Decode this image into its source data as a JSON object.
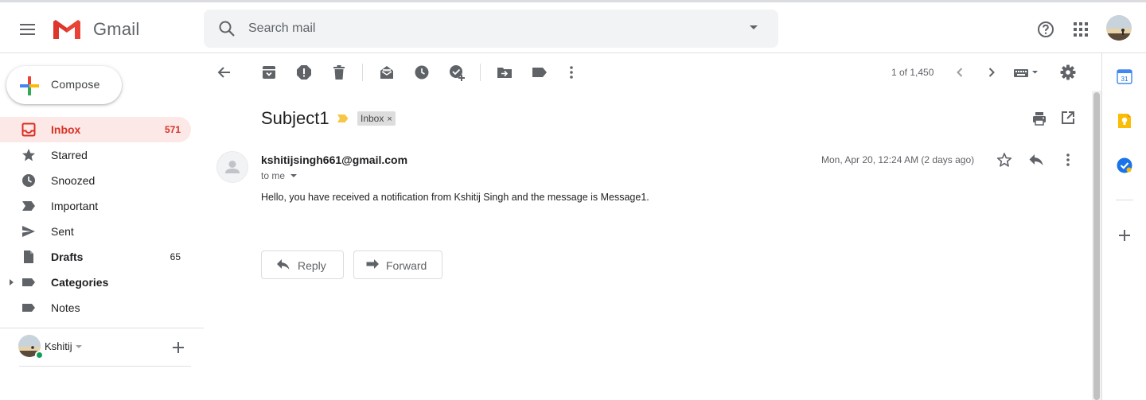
{
  "app": {
    "name": "Gmail"
  },
  "search": {
    "placeholder": "Search mail"
  },
  "nav": {
    "compose_label": "Compose",
    "items": [
      {
        "label": "Inbox",
        "count": "571"
      },
      {
        "label": "Starred",
        "count": ""
      },
      {
        "label": "Snoozed",
        "count": ""
      },
      {
        "label": "Important",
        "count": ""
      },
      {
        "label": "Sent",
        "count": ""
      },
      {
        "label": "Drafts",
        "count": "65"
      },
      {
        "label": "Categories",
        "count": ""
      },
      {
        "label": "Notes",
        "count": ""
      }
    ]
  },
  "hangouts": {
    "user_name": "Kshitij",
    "status": "online"
  },
  "toolbar": {
    "pager_text": "1 of 1,450"
  },
  "message": {
    "subject": "Subject1",
    "label_chip": "Inbox",
    "label_remove": "×",
    "sender": "kshitijsingh661@gmail.com",
    "recipient_text": "to me",
    "date": "Mon, Apr 20, 12:24 AM (2 days ago)",
    "body": "Hello, you have received a notification from Kshitij Singh and the message is Message1.",
    "reply_label": "Reply",
    "forward_label": "Forward"
  },
  "side_panel": {
    "calendar_day": "31"
  },
  "colors": {
    "gmail_red": "#ea4335",
    "active_bg": "#fce8e6",
    "active_text": "#d93025",
    "important_yellow": "#f6c744",
    "tasks_blue": "#4285f4"
  },
  "icons": [
    "menu-icon",
    "gmail-logo-icon",
    "search-icon",
    "help-icon",
    "apps-icon",
    "back-icon",
    "archive-icon",
    "report-spam-icon",
    "delete-icon",
    "mark-unread-icon",
    "snooze-icon",
    "add-to-tasks-icon",
    "move-to-icon",
    "labels-icon",
    "more-icon",
    "newer-icon",
    "older-icon",
    "input-tools-icon",
    "settings-icon",
    "print-icon",
    "open-in-new-window-icon",
    "star-icon",
    "reply-icon",
    "forward-icon",
    "calendar-icon",
    "keep-icon",
    "tasks-icon",
    "add-addon-icon"
  ]
}
